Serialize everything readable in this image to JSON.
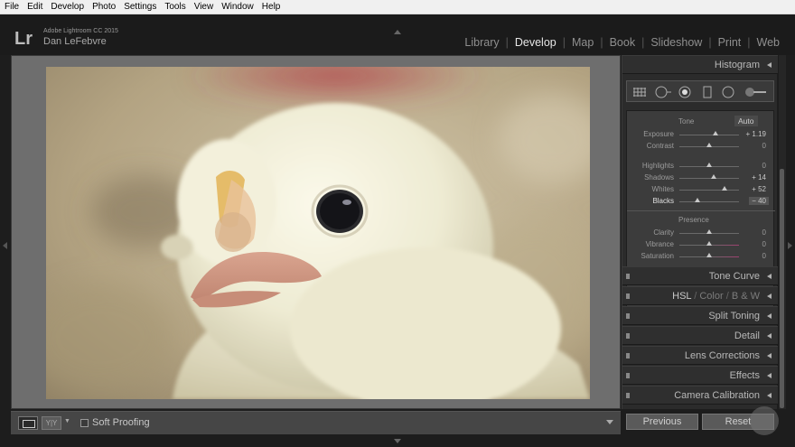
{
  "menubar": {
    "items": [
      "File",
      "Edit",
      "Develop",
      "Photo",
      "Settings",
      "Tools",
      "View",
      "Window",
      "Help"
    ]
  },
  "identity": {
    "logo": "Lr",
    "app_name": "Adobe Lightroom CC 2015",
    "user_name": "Dan LeFebvre"
  },
  "modules": [
    "Library",
    "Develop",
    "Map",
    "Book",
    "Slideshow",
    "Print",
    "Web"
  ],
  "active_module": "Develop",
  "toolbar": {
    "soft_proofing_label": "Soft Proofing",
    "soft_proofing_checked": false,
    "compare_label": "Y|Y"
  },
  "right_panel": {
    "histogram_title": "Histogram",
    "basic": {
      "tone_label": "Tone",
      "auto_label": "Auto",
      "presence_label": "Presence",
      "sliders_tone": [
        {
          "label": "Exposure",
          "value": "+ 1.19",
          "position": 0.6
        },
        {
          "label": "Contrast",
          "value": "0",
          "position": 0.5
        },
        {
          "label": "Highlights",
          "value": "0",
          "position": 0.5
        },
        {
          "label": "Shadows",
          "value": "+ 14",
          "position": 0.57
        },
        {
          "label": "Whites",
          "value": "+ 52",
          "position": 0.76
        },
        {
          "label": "Blacks",
          "value": "− 40",
          "position": 0.3
        }
      ],
      "sliders_presence": [
        {
          "label": "Clarity",
          "value": "0",
          "position": 0.5
        },
        {
          "label": "Vibrance",
          "value": "0",
          "position": 0.5
        },
        {
          "label": "Saturation",
          "value": "0",
          "position": 0.5
        }
      ]
    },
    "panels": {
      "tone_curve": "Tone Curve",
      "hsl": "HSL",
      "hsl_sep1": "/",
      "color": "Color",
      "hsl_sep2": "/",
      "bw": "B & W",
      "split_toning": "Split Toning",
      "detail": "Detail",
      "lens_corrections": "Lens Corrections",
      "effects": "Effects",
      "camera_calibration": "Camera Calibration"
    },
    "previous_label": "Previous",
    "reset_label": "Reset"
  }
}
